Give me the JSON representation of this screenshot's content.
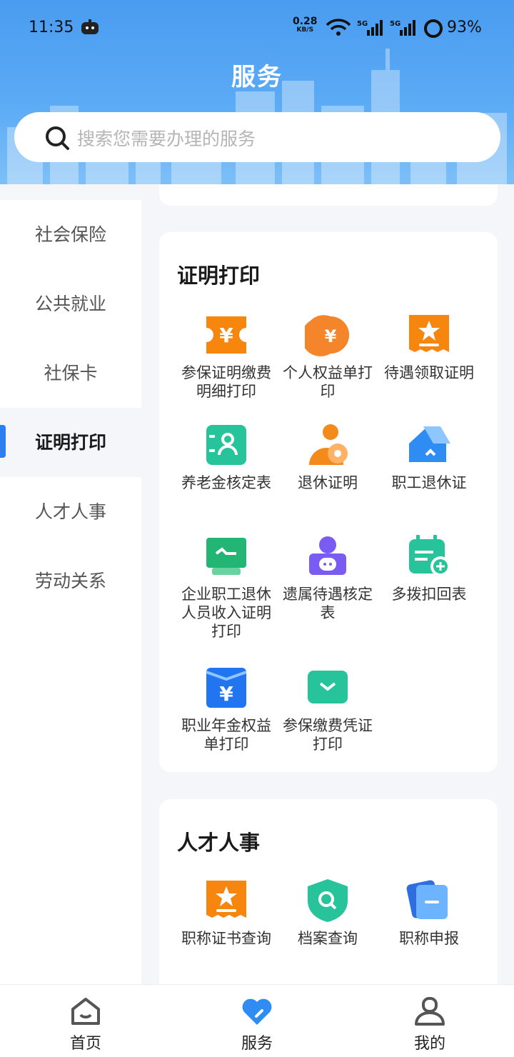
{
  "status_bar": {
    "time": "11:35",
    "net_speed": "0.28",
    "net_unit": "KB/S",
    "battery": "93%"
  },
  "header": {
    "title": "服务"
  },
  "search": {
    "placeholder": "搜索您需要办理的服务"
  },
  "sidebar": {
    "items": [
      {
        "label": "社会保险"
      },
      {
        "label": "公共就业"
      },
      {
        "label": "社保卡"
      },
      {
        "label": "证明打印",
        "active": true
      },
      {
        "label": "人才人事"
      },
      {
        "label": "劳动关系"
      }
    ]
  },
  "sections": [
    {
      "title": "证明打印",
      "items": [
        {
          "label": "参保证明缴费明细打印",
          "icon": "ticket-yen-icon",
          "color": "#f7860f"
        },
        {
          "label": "个人权益单打印",
          "icon": "yen-coin-icon",
          "color": "#f5852a"
        },
        {
          "label": "待遇领取证明",
          "icon": "star-ticket-icon",
          "color": "#f7860f"
        },
        {
          "label": "养老金核定表",
          "icon": "person-card-icon",
          "color": "#27c39a"
        },
        {
          "label": "退休证明",
          "icon": "person-coin-icon",
          "color": "#f38a1a"
        },
        {
          "label": "职工退休证",
          "icon": "house-icon",
          "color": "#2e8cf3"
        },
        {
          "label": "企业职工退休人员收入证明打印",
          "icon": "monitor-icon",
          "color": "#22b573"
        },
        {
          "label": "遗属待遇核定表",
          "icon": "person-badge-icon",
          "color": "#7a5cf2"
        },
        {
          "label": "多拨扣回表",
          "icon": "calendar-icon",
          "color": "#27c39a"
        },
        {
          "label": "职业年金权益单打印",
          "icon": "yen-envelope-icon",
          "color": "#2275f0"
        },
        {
          "label": "参保缴费凭证打印",
          "icon": "chevron-box-icon",
          "color": "#27c39a"
        }
      ]
    },
    {
      "title": "人才人事",
      "items": [
        {
          "label": "职称证书查询",
          "icon": "star-ticket-icon",
          "color": "#f7860f"
        },
        {
          "label": "档案查询",
          "icon": "search-shield-icon",
          "color": "#27c39a"
        },
        {
          "label": "职称申报",
          "icon": "cards-icon",
          "color": "#2e8cf3"
        }
      ]
    }
  ],
  "bottom_nav": [
    {
      "label": "首页",
      "icon": "home-icon"
    },
    {
      "label": "服务",
      "icon": "heart-icon",
      "active": true,
      "color": "#2e8cf3"
    },
    {
      "label": "我的",
      "icon": "user-icon"
    }
  ]
}
